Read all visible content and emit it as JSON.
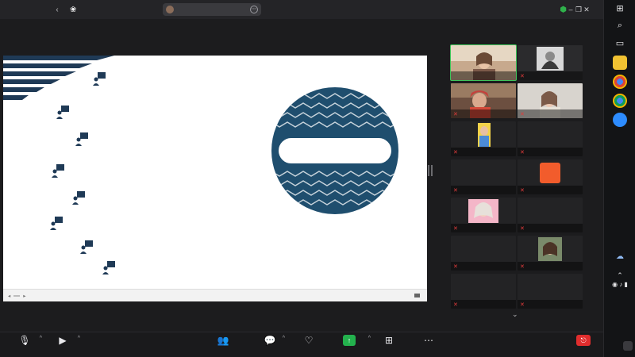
{
  "app": {
    "brand_top": "",
    "brand_bottom": "",
    "meeting_label": "",
    "share_label": "",
    "view_label": ""
  },
  "slide": {
    "lines": [
      {
        "text": ""
      },
      {
        "text": ""
      },
      {
        "text": ""
      },
      {
        "text": ""
      },
      {
        "text": ""
      },
      {
        "text": ""
      },
      {
        "text": ""
      },
      {
        "text": ""
      },
      {
        "text": ""
      },
      {
        "text": ""
      },
      {
        "text": ""
      },
      {
        "text": ""
      },
      {
        "text": ""
      },
      {
        "text": ""
      }
    ],
    "badge_text": "",
    "footer_page": "",
    "footer_brand": "",
    "page_number": ""
  },
  "participants": [
    {
      "name": "",
      "big_name": "",
      "avatar_letter": ""
    },
    {
      "name": "",
      "big_name": "",
      "avatar_letter": ""
    },
    {
      "name": "",
      "big_name": "",
      "avatar_letter": ""
    },
    {
      "name": "",
      "big_name": "",
      "avatar_letter": ""
    },
    {
      "name": "",
      "big_name": "",
      "avatar_letter": ""
    },
    {
      "name": "",
      "big_name": "",
      "avatar_letter": ""
    },
    {
      "name": "",
      "big_name": "",
      "avatar_letter": ""
    },
    {
      "name": "",
      "big_name": "",
      "avatar_letter": ""
    },
    {
      "name": "",
      "big_name": "",
      "avatar_letter": ""
    },
    {
      "name": "",
      "big_name": "",
      "avatar_letter": ""
    },
    {
      "name": "",
      "big_name": "",
      "avatar_letter": ""
    },
    {
      "name": "",
      "big_name": "",
      "avatar_letter": ""
    },
    {
      "name": "",
      "big_name": "",
      "avatar_letter": ""
    },
    {
      "name": "",
      "big_name": "",
      "avatar_letter": ""
    }
  ],
  "toolbar": {
    "audio": "",
    "video": "",
    "participants": "",
    "participants_count": "",
    "chat": "",
    "react": "",
    "share": "",
    "apps": "",
    "more": "",
    "leave": ""
  },
  "taskbar": {
    "language": "",
    "time": "",
    "date": "",
    "notifications": ""
  },
  "colors": {
    "accent_green": "#23b14d",
    "leave_red": "#e02d2d",
    "slide_navy": "#1f4e6e",
    "active_speaker": "#3ec45a",
    "avatar_orange": "#f25c2c"
  },
  "icons": {
    "topbar": [
      "back-icon",
      "paw-icon",
      "shield-icon",
      "minimize-icon",
      "restore-icon",
      "close-icon"
    ],
    "toolbar": [
      "microphone-off-icon",
      "video-camera-off-icon",
      "participants-icon",
      "chat-icon",
      "heart-react-icon",
      "share-arrow-icon",
      "apps-icon",
      "more-icon",
      "leave-icon"
    ]
  }
}
